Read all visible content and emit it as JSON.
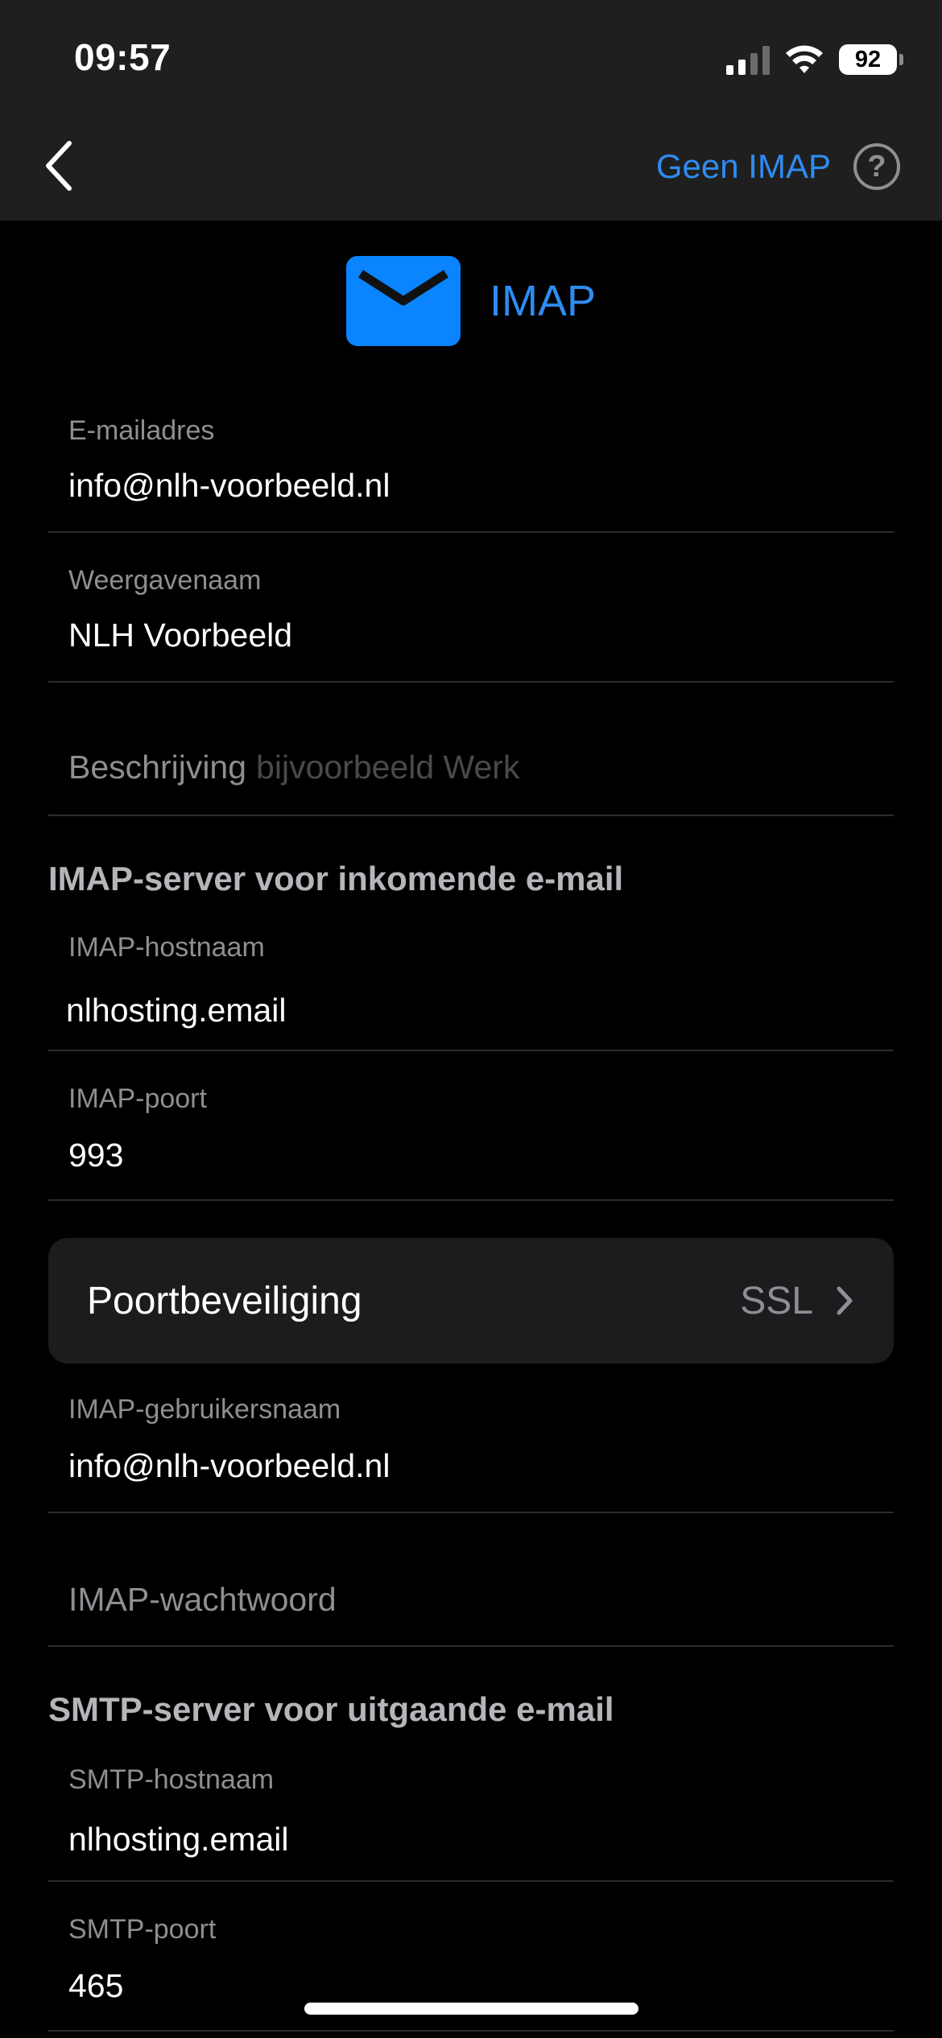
{
  "status_bar": {
    "time": "09:57",
    "battery": "92"
  },
  "nav": {
    "right_link": "Geen IMAP",
    "help": "?"
  },
  "header": {
    "title": "IMAP"
  },
  "fields": {
    "email": {
      "label": "E-mailadres",
      "value": "info@nlh-voorbeeld.nl"
    },
    "display_name": {
      "label": "Weergavenaam",
      "value": "NLH Voorbeeld"
    },
    "description": {
      "label": "Beschrijving",
      "placeholder": "bijvoorbeeld Werk"
    },
    "imap_host": {
      "label": "IMAP-hostnaam",
      "value": "nlhosting.email"
    },
    "imap_port": {
      "label": "IMAP-poort",
      "value": "993"
    },
    "port_security": {
      "label": "Poortbeveiliging",
      "value": "SSL"
    },
    "imap_user": {
      "label": "IMAP-gebruikersnaam",
      "value": "info@nlh-voorbeeld.nl"
    },
    "imap_password": {
      "label": "IMAP-wachtwoord"
    },
    "smtp_host": {
      "label": "SMTP-hostnaam",
      "value": "nlhosting.email"
    },
    "smtp_port": {
      "label": "SMTP-poort",
      "value": "465"
    }
  },
  "sections": {
    "incoming": "IMAP-server voor inkomende e-mail",
    "outgoing": "SMTP-server voor uitgaande e-mail"
  },
  "colors": {
    "accent": "#2e8cf0",
    "mail_icon": "#0a84ff",
    "background": "#000000",
    "bar": "#1f1f1f"
  },
  "icons": {
    "back": "chevron-left-icon",
    "help": "question-circle-icon",
    "mail": "envelope-icon",
    "chevron": "chevron-right-icon"
  }
}
